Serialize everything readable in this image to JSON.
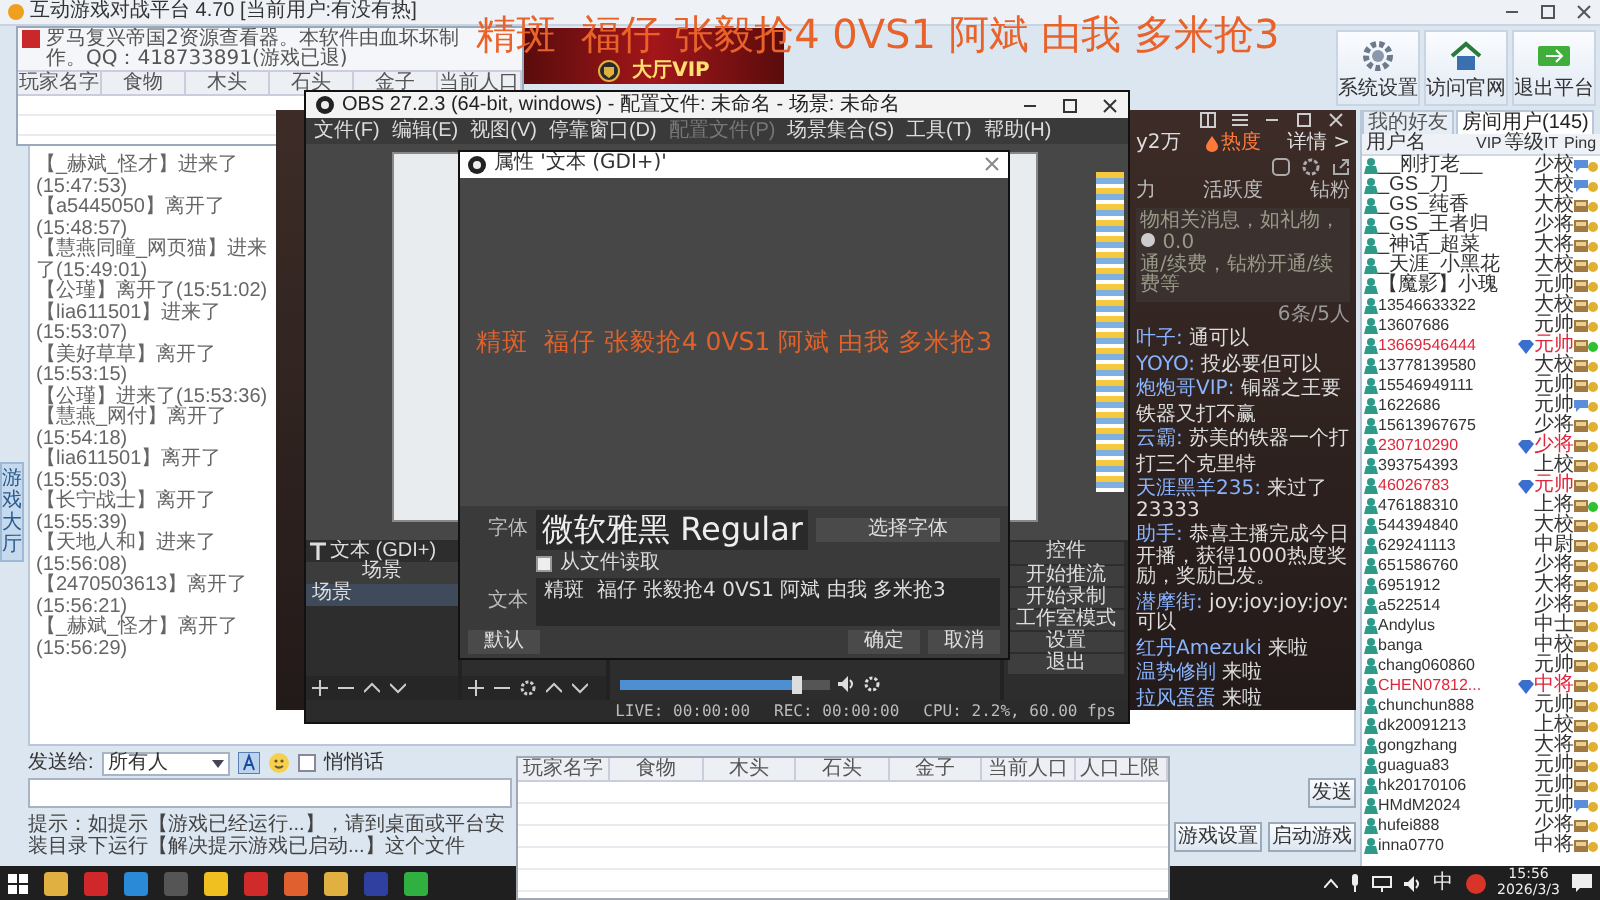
{
  "platform": {
    "title": "互动游戏对战平台 4.70 [当前用户:有没有热]",
    "toolbar": [
      {
        "label": "系统设置",
        "kind": "settings"
      },
      {
        "label": "访问官网",
        "kind": "website"
      },
      {
        "label": "退出平台",
        "kind": "exit"
      }
    ],
    "lobby_tab": "游戏大厅",
    "chat_log": [
      "【_赫斌_怪才】进来了(15:47:53)",
      "【a5445050】离开了(15:48:57)",
      "【慧燕同瞳_网页猫】进来了(15:49:01)",
      "【公瑾】离开了(15:51:02)",
      "【lia611501】进来了(15:53:07)",
      "【美好草草】离开了(15:53:15)",
      "【公瑾】进来了(15:53:36)",
      "【慧燕_网付】离开了(15:54:18)",
      "【lia611501】离开了(15:55:03)",
      "【长宁战士】离开了(15:55:39)",
      "【天地人和】进来了(15:56:08)",
      "【2470503613】离开了(15:56:21)",
      "【_赫斌_怪才】离开了(15:56:29)"
    ],
    "send_to_label": "发送给:",
    "send_to_value": "所有人",
    "whisper": {
      "label": "悄悄话",
      "checked": false
    },
    "send_button": "发送",
    "tip": "提示：如提示【游戏已经运行...】，请到桌面或平台安装目录下运行【解决提示游戏已启动...】这个文件",
    "buttons": [
      "游戏设置",
      "启动游戏"
    ],
    "user_tabs": [
      {
        "label": "我的好友",
        "selected": false
      },
      {
        "label": "房间用户(145)",
        "selected": true
      }
    ],
    "user_columns": [
      "用户名",
      "VIP",
      "等级",
      "IT",
      "Ping"
    ],
    "users": [
      {
        "name": "__刚打老__",
        "vip": false,
        "rank": "少校",
        "kind": "chat",
        "color": "#e0b030"
      },
      {
        "name": "_GS_刀",
        "vip": false,
        "rank": "大校",
        "kind": "chat",
        "color": "#e0b030"
      },
      {
        "name": "_GS_莼香",
        "vip": false,
        "rank": "大校",
        "kind": "card",
        "color": "#e0b030"
      },
      {
        "name": "_GS_王者归",
        "vip": false,
        "rank": "少将",
        "kind": "card",
        "color": "#e0b030"
      },
      {
        "name": "_神话_超菜",
        "vip": false,
        "rank": "大将",
        "kind": "card",
        "color": "#e0b030"
      },
      {
        "name": "_天涯_小黑花",
        "vip": false,
        "rank": "大校",
        "kind": "card",
        "color": "#e0b030"
      },
      {
        "name": "【魔影】小瑰",
        "vip": false,
        "rank": "元帅",
        "kind": "card",
        "color": "#e0b030"
      },
      {
        "name": "13546633322",
        "vip": false,
        "rank": "大校",
        "kind": "card",
        "color": "#e0b030"
      },
      {
        "name": "13607686",
        "vip": false,
        "rank": "元帅",
        "kind": "card",
        "color": "#e0b030"
      },
      {
        "name": "13669546444",
        "vip": true,
        "rank": "元帅",
        "kind": "card",
        "color": "#30c030"
      },
      {
        "name": "13778139580",
        "vip": false,
        "rank": "大校",
        "kind": "card",
        "color": "#e0b030"
      },
      {
        "name": "15546949111",
        "vip": false,
        "rank": "元帅",
        "kind": "card",
        "color": "#e0b030"
      },
      {
        "name": "1622686",
        "vip": false,
        "rank": "元帅",
        "kind": "chat",
        "color": "#e0b030"
      },
      {
        "name": "15613967675",
        "vip": false,
        "rank": "少将",
        "kind": "card",
        "color": "#e0b030"
      },
      {
        "name": "230710290",
        "vip": true,
        "rank": "少将",
        "kind": "card",
        "color": "#e0b030"
      },
      {
        "name": "393754393",
        "vip": false,
        "rank": "上校",
        "kind": "card",
        "color": "#e0b030"
      },
      {
        "name": "46026783",
        "vip": true,
        "rank": "元帅",
        "kind": "card",
        "color": "#e0b030"
      },
      {
        "name": "476188310",
        "vip": false,
        "rank": "上将",
        "kind": "card",
        "color": "#30c030"
      },
      {
        "name": "544394840",
        "vip": false,
        "rank": "大校",
        "kind": "card",
        "color": "#e0b030"
      },
      {
        "name": "629241113",
        "vip": false,
        "rank": "中尉",
        "kind": "card",
        "color": "#e0b030"
      },
      {
        "name": "651586760",
        "vip": false,
        "rank": "少将",
        "kind": "card",
        "color": "#e0b030"
      },
      {
        "name": "6951912",
        "vip": false,
        "rank": "大将",
        "kind": "card",
        "color": "#e0b030"
      },
      {
        "name": "a522514",
        "vip": false,
        "rank": "少将",
        "kind": "card",
        "color": "#e0b030"
      },
      {
        "name": "Andylus",
        "vip": false,
        "rank": "中士",
        "kind": "card",
        "color": "#e0b030"
      },
      {
        "name": "banga",
        "vip": false,
        "rank": "中校",
        "kind": "card",
        "color": "#e0b030"
      },
      {
        "name": "chang060860",
        "vip": false,
        "rank": "元帅",
        "kind": "card",
        "color": "#e0b030"
      },
      {
        "name": "CHEN07812...",
        "vip": true,
        "rank": "中将",
        "kind": "card",
        "color": "#e0b030"
      },
      {
        "name": "chunchun888",
        "vip": false,
        "rank": "元帅",
        "kind": "card",
        "color": "#e0b030"
      },
      {
        "name": "dk20091213",
        "vip": false,
        "rank": "上校",
        "kind": "card",
        "color": "#e0b030"
      },
      {
        "name": "gongzhang",
        "vip": false,
        "rank": "大将",
        "kind": "card",
        "color": "#e0b030"
      },
      {
        "name": "guagua83",
        "vip": false,
        "rank": "元帅",
        "kind": "card",
        "color": "#e0b030"
      },
      {
        "name": "hk20170106",
        "vip": false,
        "rank": "元帅",
        "kind": "card",
        "color": "#e0b030"
      },
      {
        "name": "HMdM2024",
        "vip": false,
        "rank": "元帅",
        "kind": "chat",
        "color": "#e0b030"
      },
      {
        "name": "hufei888",
        "vip": false,
        "rank": "少将",
        "kind": "card",
        "color": "#e0b030"
      },
      {
        "name": "inna0770",
        "vip": false,
        "rank": "中将",
        "kind": "card",
        "color": "#e0b030"
      }
    ]
  },
  "resource_viewer": {
    "title": "罗马复兴帝国2资源查看器。本软件由血坏坏制作。QQ：418733891(游戏已退)",
    "columns": [
      "玩家名字",
      "食物",
      "木头",
      "石头",
      "金子",
      "当前人口"
    ]
  },
  "banner": {
    "text": "大厅VIP"
  },
  "overlay_text": "精斑  福仔 张毅抢4 0VS1 阿斌 由我 多米抢3",
  "stream_app": {
    "heat_value": "y2万",
    "heat_label": "热度",
    "details": "详情 >",
    "tabs": [
      "力",
      "活跃度",
      "钻粉"
    ],
    "notice": [
      "物相关消息，如礼物，",
      "通/续费，钻粉开通/续费等"
    ],
    "coins": "0.0",
    "count": "6条/5人",
    "messages": [
      {
        "user": "叶子:",
        "text": "通可以"
      },
      {
        "user": "YOYO:",
        "text": "投必要但可以"
      },
      {
        "user": "炮炮哥VIP:",
        "text": "铜器之王要"
      },
      {
        "text": "铁器又打不赢"
      },
      {
        "user": "云霸:",
        "text": "苏美的铁器一个打"
      },
      {
        "text": "打三个克里特"
      },
      {
        "user": "天涯黑羊235:",
        "text": "来过了23333"
      },
      {
        "user": "助手:",
        "text": "恭喜主播完成今日开播，获得1000热度奖励，奖励已发。"
      },
      {
        "user": "潜摩街:",
        "text": "joy:joy:joy:joy:可以"
      },
      {
        "user": "红丹Amezuki",
        "text": "来啦"
      },
      {
        "user": "温势修削",
        "text": "来啦"
      },
      {
        "user": "拉风蛋蛋",
        "text": "来啦"
      }
    ]
  },
  "obs": {
    "title": "OBS 27.2.3 (64-bit, windows) - 配置文件: 未命名 - 场景: 未命名",
    "menu": [
      {
        "label": "文件(F)",
        "disabled": false
      },
      {
        "label": "编辑(E)",
        "disabled": false
      },
      {
        "label": "视图(V)",
        "disabled": false
      },
      {
        "label": "停靠窗口(D)",
        "disabled": false
      },
      {
        "label": "配置文件(P)",
        "disabled": true
      },
      {
        "label": "场景集合(S)",
        "disabled": false
      },
      {
        "label": "工具(T)",
        "disabled": false
      },
      {
        "label": "帮助(H)",
        "disabled": false
      }
    ],
    "source": "文本 (GDI+)",
    "scenes_header": "场景",
    "scenes": [
      "场景"
    ],
    "mixer": {
      "level": 0.85
    },
    "controls_header": "控件",
    "controls": [
      "开始推流",
      "开始录制",
      "工作室模式",
      "设置",
      "退出"
    ],
    "status": [
      "LIVE: 00:00:00",
      "REC: 00:00:00",
      "CPU: 2.2%, 60.00 fps"
    ],
    "properties": {
      "title": "属性 '文本 (GDI+)'",
      "preview_text": "精斑  福仔 张毅抢4 0VS1 阿斌 由我 多米抢3",
      "font_label": "字体",
      "font_value": "微软雅黑 Regular",
      "choose_font": "选择字体",
      "from_file": {
        "label": "从文件读取",
        "checked": false
      },
      "text_label": "文本",
      "text_value": "精斑  福仔 张毅抢4 0VS1 阿斌 由我 多米抢3",
      "buttons": [
        "默认",
        "确定",
        "取消"
      ]
    }
  },
  "player_table": {
    "columns": [
      "玩家名字",
      "食物",
      "木头",
      "石头",
      "金子",
      "当前人口",
      "人口上限"
    ]
  },
  "taskbar": {
    "ime": "中",
    "time": "15:56",
    "date": "2026/3/3"
  }
}
